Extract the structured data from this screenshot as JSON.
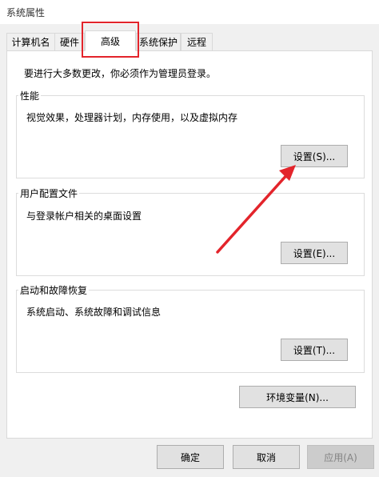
{
  "window": {
    "title": "系统属性"
  },
  "tabs": [
    {
      "label": "计算机名"
    },
    {
      "label": "硬件"
    },
    {
      "label": "高级"
    },
    {
      "label": "系统保护"
    },
    {
      "label": "远程"
    }
  ],
  "panel": {
    "intro": "要进行大多数更改，你必须作为管理员登录。",
    "performance": {
      "title": "性能",
      "description": "视觉效果，处理器计划，内存使用，以及虚拟内存",
      "button": "设置(S)..."
    },
    "user_profiles": {
      "title": "用户配置文件",
      "description": "与登录帐户相关的桌面设置",
      "button": "设置(E)..."
    },
    "startup_recovery": {
      "title": "启动和故障恢复",
      "description": "系统启动、系统故障和调试信息",
      "button": "设置(T)..."
    },
    "env_button": "环境变量(N)..."
  },
  "footer": {
    "ok": "确定",
    "cancel": "取消",
    "apply": "应用(A)"
  },
  "colors": {
    "annotation": "#e3242b",
    "panel_bg": "#ffffff",
    "window_bg": "#f0f0f0"
  }
}
